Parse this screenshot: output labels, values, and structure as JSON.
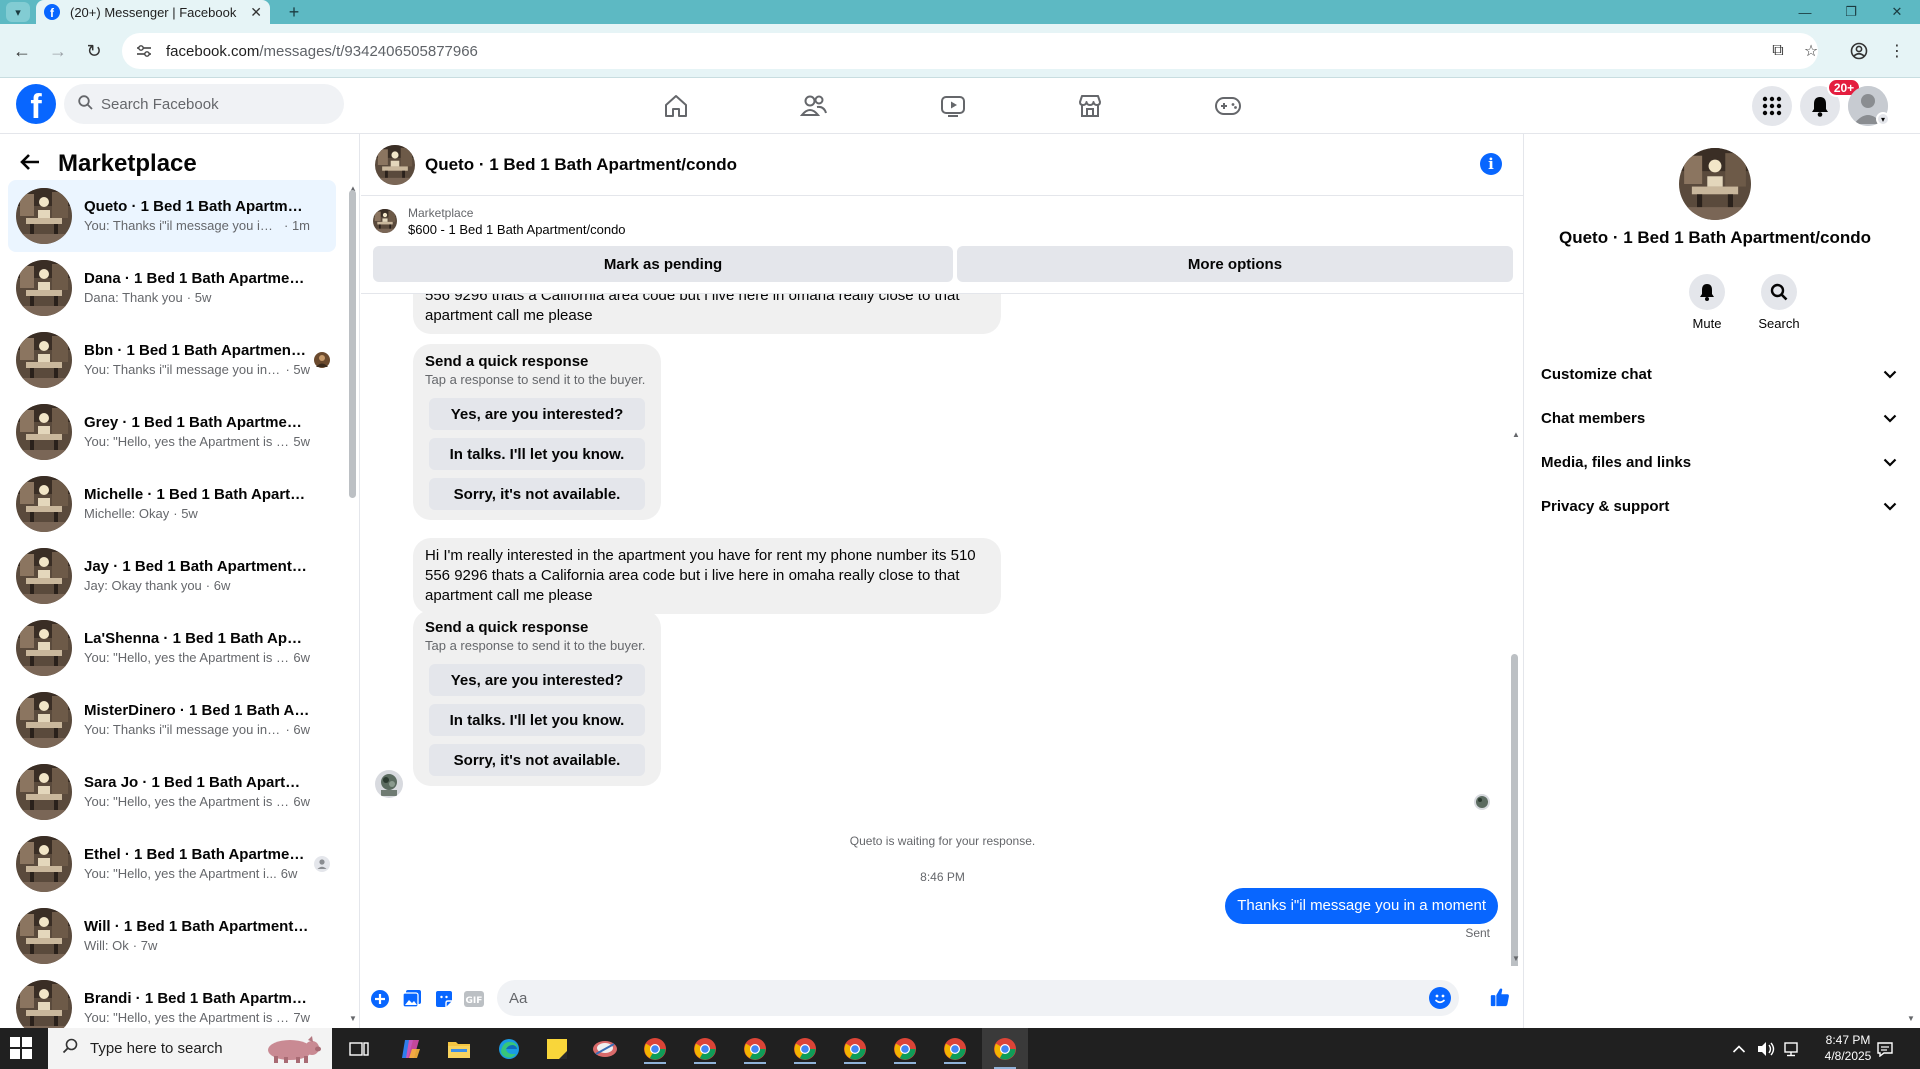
{
  "browser": {
    "tab_title": "(20+) Messenger | Facebook",
    "url_host": "facebook.com",
    "url_path": "/messages/t/9342406505877966"
  },
  "header": {
    "search_placeholder": "Search Facebook",
    "notification_badge": "20+"
  },
  "sidebar": {
    "title": "Marketplace",
    "conversations": [
      {
        "name": "Queto · 1 Bed 1 Bath Apartment/...",
        "preview": "You: Thanks i\"il message you in a ...",
        "time": "· 1m",
        "active": true
      },
      {
        "name": "Dana · 1 Bed 1 Bath Apartment/c...",
        "preview": "Dana: Thank you",
        "time": "· 5w"
      },
      {
        "name": "Bbn · 1 Bed 1 Bath Apartment/...",
        "preview": "You: Thanks i\"il message you in ...",
        "time": "· 5w",
        "mini": "photo"
      },
      {
        "name": "Grey · 1 Bed 1 Bath Apartment/c...",
        "preview": "You: \"Hello, yes the Apartment is st...",
        "time": "5w"
      },
      {
        "name": "Michelle · 1 Bed 1 Bath Apartme...",
        "preview": "Michelle: Okay",
        "time": "· 5w"
      },
      {
        "name": "Jay · 1 Bed 1 Bath Apartment/co...",
        "preview": "Jay: Okay thank you",
        "time": "· 6w"
      },
      {
        "name": "La'Shenna · 1 Bed 1 Bath Apartm...",
        "preview": "You: \"Hello, yes the Apartment is st...",
        "time": "6w"
      },
      {
        "name": "MisterDinero · 1 Bed 1 Bath Apar...",
        "preview": "You: Thanks i\"il message you in a ...",
        "time": "· 6w"
      },
      {
        "name": "Sara Jo · 1 Bed 1 Bath Apartment...",
        "preview": "You: \"Hello, yes the Apartment is st...",
        "time": "6w"
      },
      {
        "name": "Ethel · 1 Bed 1 Bath Apartmen...",
        "preview": "You: \"Hello, yes the Apartment i...",
        "time": "6w",
        "mini": "person"
      },
      {
        "name": "Will · 1 Bed 1 Bath Apartment/co...",
        "preview": "Will: Ok",
        "time": "· 7w"
      },
      {
        "name": "Brandi · 1 Bed 1 Bath Apartment...",
        "preview": "You: \"Hello, yes the Apartment is st...",
        "time": "7w"
      }
    ]
  },
  "chat": {
    "title": "Queto · 1 Bed 1 Bath Apartment/condo",
    "listing_source": "Marketplace",
    "listing_name": "$600 - 1 Bed 1 Bath Apartment/condo",
    "mark_pending_label": "Mark as pending",
    "more_options_label": "More options",
    "message_partial": "556 9296 thats a California area code but i live here in omaha really close to that apartment call me please",
    "message_full": "Hi I'm really interested in the apartment you have for rent my phone number its 510 556 9296 thats a California area code but i live here in omaha really close to that apartment call me please",
    "quick_response": {
      "title": "Send a quick response",
      "subtitle": "Tap a response to send it to the buyer.",
      "options": [
        "Yes, are you interested?",
        "In talks. I'll let you know.",
        "Sorry, it's not available."
      ]
    },
    "waiting_text": "Queto is waiting for your response.",
    "timestamp": "8:46 PM",
    "my_message": "Thanks i\"il message you in a moment",
    "sent_label": "Sent",
    "composer_placeholder": "Aa"
  },
  "right_panel": {
    "name": "Queto · 1 Bed 1 Bath Apartment/condo",
    "mute_label": "Mute",
    "search_label": "Search",
    "sections": [
      "Customize chat",
      "Chat members",
      "Media, files and links",
      "Privacy & support"
    ]
  },
  "taskbar": {
    "search_placeholder": "Type here to search",
    "time": "8:47 PM",
    "date": "4/8/2025"
  },
  "colors": {
    "brand": "#0866ff",
    "tabbar": "#5db9c3",
    "badge": "#e41e3f"
  }
}
